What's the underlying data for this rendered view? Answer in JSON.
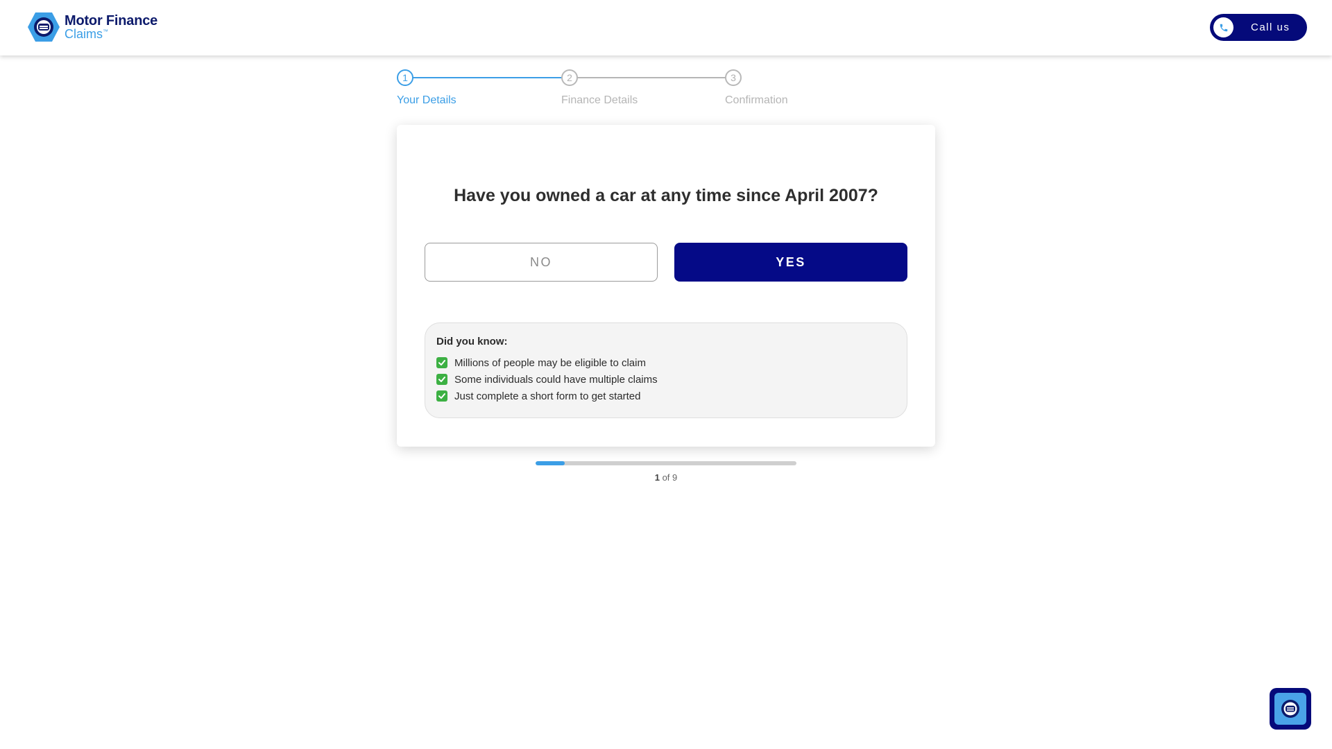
{
  "brand": {
    "name_line1": "Motor Finance",
    "name_line2": "Claims",
    "trademark": "™",
    "primary_color": "#050a7a",
    "accent_color": "#3b9ee6"
  },
  "header": {
    "call_label": "Call us",
    "call_icon": "phone-icon"
  },
  "stepper": {
    "steps": [
      {
        "number": "1",
        "label": "Your Details",
        "active": true
      },
      {
        "number": "2",
        "label": "Finance Details",
        "active": false
      },
      {
        "number": "3",
        "label": "Confirmation",
        "active": false
      }
    ]
  },
  "question": {
    "text": "Have you owned a car at any time since April 2007?",
    "no_label": "NO",
    "yes_label": "YES"
  },
  "info": {
    "title": "Did you know:",
    "items": [
      "Millions of people may be eligible to claim",
      "Some individuals could have multiple claims",
      "Just complete a short form to get started"
    ],
    "item_icon": "check-mark-icon"
  },
  "progress": {
    "current": "1",
    "separator": "of",
    "total": "9",
    "fraction": 0.111
  },
  "widget": {
    "icon": "brand-logo-icon"
  }
}
